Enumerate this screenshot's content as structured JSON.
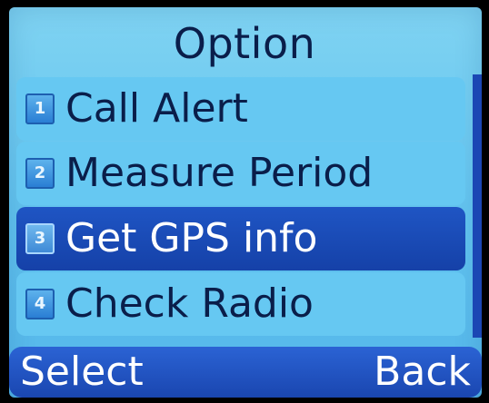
{
  "screen": {
    "title": "Option"
  },
  "menu": {
    "items": [
      {
        "number": "1",
        "label": "Call Alert",
        "selected": false
      },
      {
        "number": "2",
        "label": "Measure Period",
        "selected": false
      },
      {
        "number": "3",
        "label": "Get GPS info",
        "selected": true
      },
      {
        "number": "4",
        "label": "Check Radio",
        "selected": false
      }
    ]
  },
  "softkeys": {
    "left": "Select",
    "right": "Back"
  },
  "colors": {
    "background": "#61c2ee",
    "selection": "#1a46b0",
    "text": "#0a1e4a",
    "selected_text": "#ffffff",
    "softkey_bar": "#1f55c4",
    "scrollbar": "#1b47b4"
  }
}
